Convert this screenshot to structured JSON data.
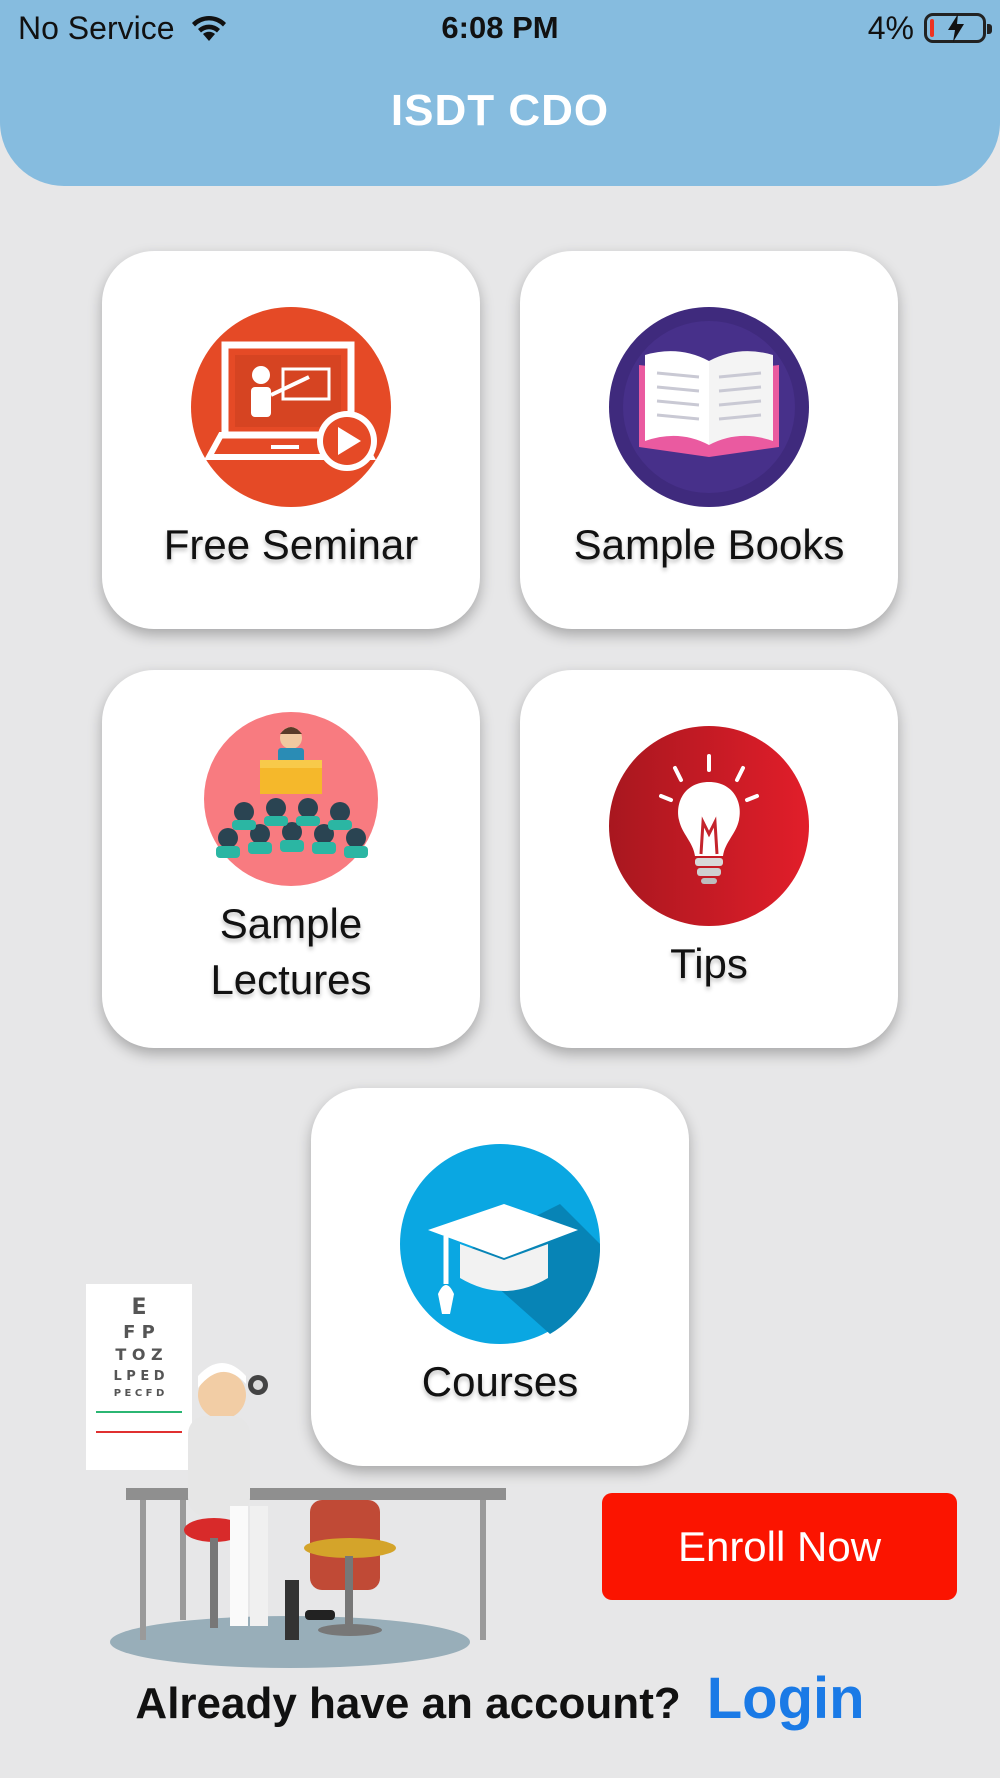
{
  "status_bar": {
    "carrier": "No Service",
    "time": "6:08 PM",
    "battery": "4%"
  },
  "header": {
    "title": "ISDT CDO"
  },
  "menu": {
    "free_seminar": "Free Seminar",
    "sample_books": "Sample Books",
    "sample_lectures_line1": "Sample",
    "sample_lectures_line2": "Lectures",
    "tips": "Tips",
    "courses": "Courses"
  },
  "enroll": {
    "label": "Enroll Now"
  },
  "footer": {
    "prompt": "Already have an account?",
    "login": "Login"
  },
  "colors": {
    "header_bg": "#86bcdf",
    "page_bg": "#e7e7e8",
    "enroll_bg": "#fb1400",
    "login_link": "#1a7ae6"
  }
}
